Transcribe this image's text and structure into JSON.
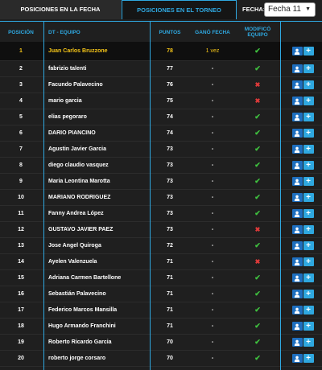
{
  "tabs": {
    "active": "POSICIONES EN LA FECHA",
    "inactive": "POSICIONES EN EL TORNEO"
  },
  "fecha": {
    "label": "FECHA:",
    "selected": "Fecha 11"
  },
  "columns": {
    "pos": "POSICIÓN",
    "team": "DT - EQUIPO",
    "pts": "PUNTOS",
    "gano": "GANÓ FECHA",
    "mod": "MODIFICÓ EQUIPO"
  },
  "rows": [
    {
      "pos": "1",
      "name": "Juan Carlos Bruzzone",
      "pts": "78",
      "gano": "1 vez",
      "mod": "check"
    },
    {
      "pos": "2",
      "name": "fabrizio talenti",
      "pts": "77",
      "gano": "-",
      "mod": "check"
    },
    {
      "pos": "3",
      "name": "Facundo Palavecino",
      "pts": "76",
      "gano": "-",
      "mod": "cross"
    },
    {
      "pos": "4",
      "name": "mario garcia",
      "pts": "75",
      "gano": "-",
      "mod": "cross"
    },
    {
      "pos": "5",
      "name": "elias pegoraro",
      "pts": "74",
      "gano": "-",
      "mod": "check"
    },
    {
      "pos": "6",
      "name": "DARIO PIANCINO",
      "pts": "74",
      "gano": "-",
      "mod": "check"
    },
    {
      "pos": "7",
      "name": "Agustin Javier Garcia",
      "pts": "73",
      "gano": "-",
      "mod": "check"
    },
    {
      "pos": "8",
      "name": "diego claudio vasquez",
      "pts": "73",
      "gano": "-",
      "mod": "check"
    },
    {
      "pos": "9",
      "name": "Maria Leontina Marotta",
      "pts": "73",
      "gano": "-",
      "mod": "check"
    },
    {
      "pos": "10",
      "name": "MARIANO RODRIGUEZ",
      "pts": "73",
      "gano": "-",
      "mod": "check"
    },
    {
      "pos": "11",
      "name": "Fanny Andrea López",
      "pts": "73",
      "gano": "-",
      "mod": "check"
    },
    {
      "pos": "12",
      "name": "GUSTAVO JAVIER PAEZ",
      "pts": "73",
      "gano": "-",
      "mod": "cross"
    },
    {
      "pos": "13",
      "name": "Jose Angel Quiroga",
      "pts": "72",
      "gano": "-",
      "mod": "check"
    },
    {
      "pos": "14",
      "name": "Ayelen Valenzuela",
      "pts": "71",
      "gano": "-",
      "mod": "cross"
    },
    {
      "pos": "15",
      "name": "Adriana Carmen Bartellone",
      "pts": "71",
      "gano": "-",
      "mod": "check"
    },
    {
      "pos": "16",
      "name": "Sebastián Palavecino",
      "pts": "71",
      "gano": "-",
      "mod": "check"
    },
    {
      "pos": "17",
      "name": "Federico Marcos Mansilla",
      "pts": "71",
      "gano": "-",
      "mod": "check"
    },
    {
      "pos": "18",
      "name": "Hugo Armando Franchini",
      "pts": "71",
      "gano": "-",
      "mod": "check"
    },
    {
      "pos": "19",
      "name": "Roberto Ricardo Garcia",
      "pts": "70",
      "gano": "-",
      "mod": "check"
    },
    {
      "pos": "20",
      "name": "roberto jorge corsaro",
      "pts": "70",
      "gano": "-",
      "mod": "check"
    }
  ],
  "icons": {
    "view": "user-icon",
    "add": "plus-icon",
    "yes": "check-icon",
    "no": "cross-icon"
  },
  "colors": {
    "accent": "#2fa8e0",
    "highlight": "#f5c518",
    "check": "#3fc23f",
    "cross": "#e03a3a"
  },
  "glyphs": {
    "check": "✔",
    "cross": "✖",
    "plus": "+",
    "caret": "▼"
  }
}
